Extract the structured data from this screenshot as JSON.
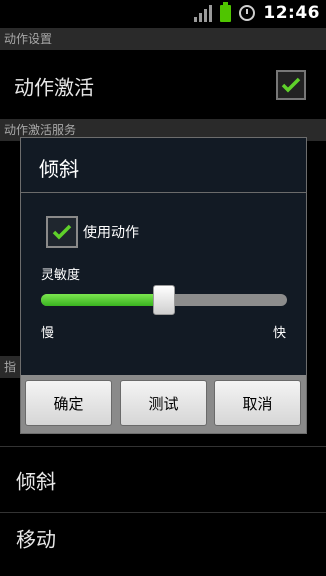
{
  "status_bar": {
    "time": "12:46"
  },
  "sections": {
    "header1": "动作设置",
    "header2": "动作激活服务",
    "header3": "指"
  },
  "prefs": {
    "activate_title": "动作激活",
    "tilt_title": "倾斜",
    "move_title": "移动"
  },
  "dialog": {
    "title": "倾斜",
    "use_motion_label": "使用动作",
    "use_motion_checked": true,
    "sensitivity_label": "灵敏度",
    "slider_value_percent": 50,
    "slow_label": "慢",
    "fast_label": "快",
    "buttons": {
      "ok": "确定",
      "test": "测试",
      "cancel": "取消"
    }
  },
  "colors": {
    "check": "#5fd12a",
    "slider_fill": "#4fc52f"
  }
}
